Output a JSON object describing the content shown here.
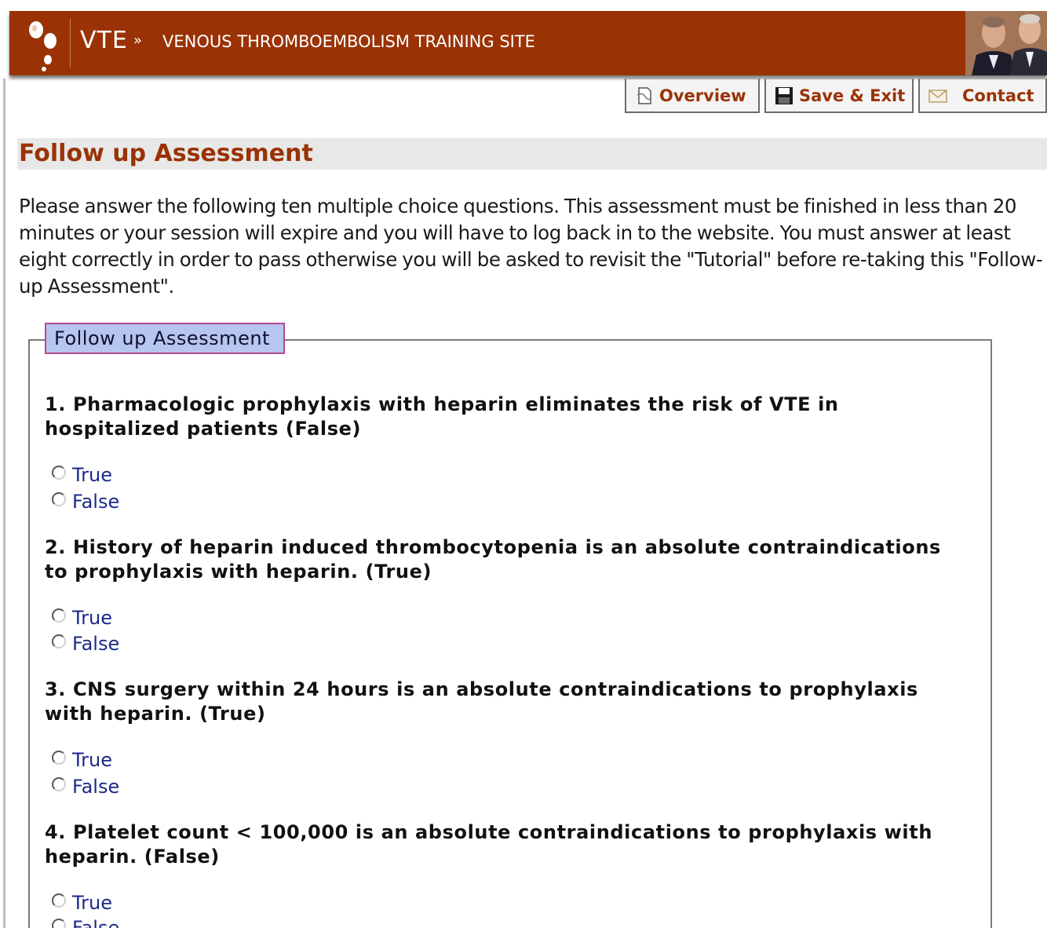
{
  "header": {
    "brand": "VTE",
    "crumb_separator": "»",
    "site_title": "VENOUS THROMBOEMBOLISM TRAINING SITE"
  },
  "nav": {
    "overview_label": "Overview",
    "save_exit_label": "Save & Exit",
    "contact_label": "Contact"
  },
  "main": {
    "page_title": "Follow up Assessment",
    "intro": "Please answer the following ten multiple choice questions. This assessment must be finished in less than 20 minutes or your session will expire and you will have to log back in to the website. You must answer at least eight correctly in order to pass otherwise you will be asked to revisit the \"Tutorial\" before re-taking this \"Follow-up Assessment\".",
    "legend": "Follow up Assessment",
    "questions": [
      {
        "text": "1. Pharmacologic prophylaxis with heparin eliminates the risk of VTE in hospitalized patients (False)",
        "options": [
          "True",
          "False"
        ]
      },
      {
        "text": "2. History of heparin induced thrombocytopenia is an absolute contraindications to prophylaxis with heparin. (True)",
        "options": [
          "True",
          "False"
        ]
      },
      {
        "text": "3. CNS surgery within 24 hours is an absolute contraindications to prophylaxis with heparin. (True)",
        "options": [
          "True",
          "False"
        ]
      },
      {
        "text": "4. Platelet count < 100,000 is an absolute contraindications to prophylaxis with heparin. (False)",
        "options": [
          "True",
          "False"
        ]
      }
    ]
  },
  "icons": {
    "logo": "vte-logo-icon",
    "overview": "document-icon",
    "save": "floppy-disk-icon",
    "contact": "envelope-icon",
    "radio": "radio-button"
  },
  "colors": {
    "header_bg": "#9a3206",
    "title_color": "#9a3206",
    "legend_bg": "#b7c6ee",
    "legend_border": "#b24a8c",
    "option_text": "#1b2a8a"
  }
}
